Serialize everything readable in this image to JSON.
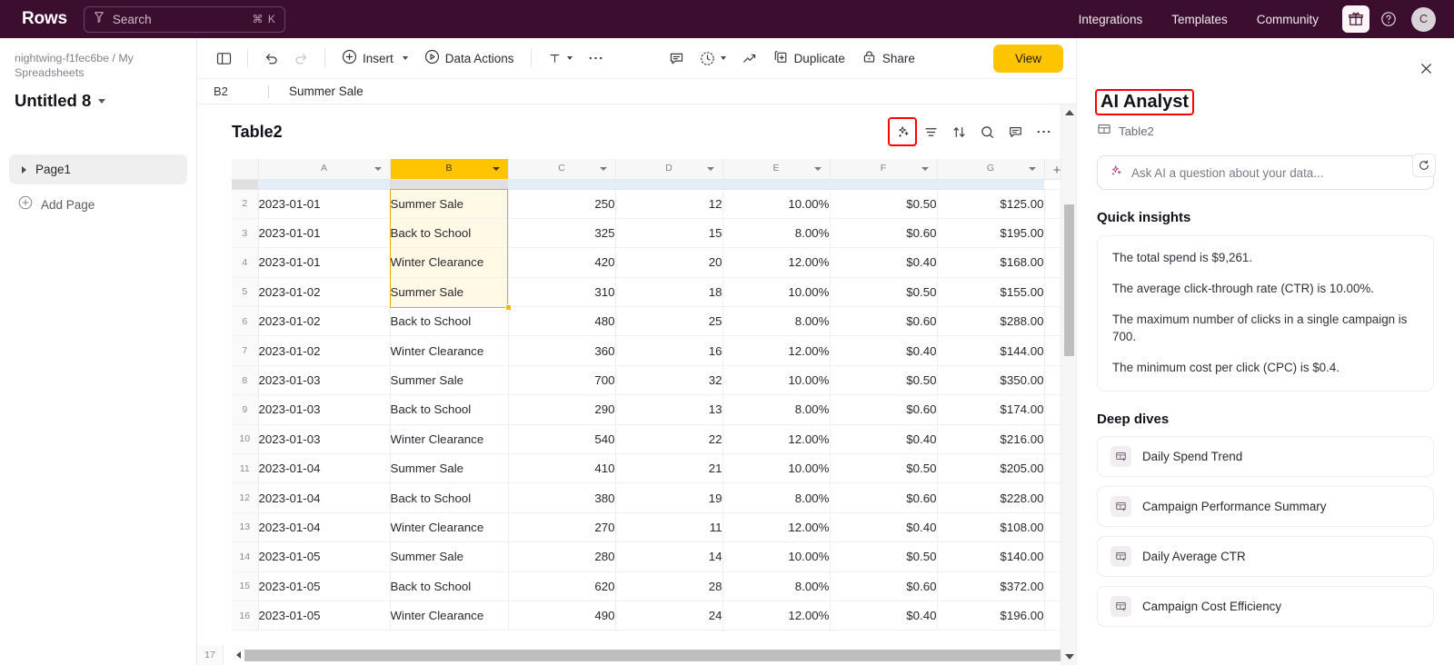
{
  "topnav": {
    "brand": "Rows",
    "search_placeholder": "Search",
    "search_shortcut": "⌘ K",
    "links": [
      {
        "label": "Integrations"
      },
      {
        "label": "Templates"
      },
      {
        "label": "Community"
      }
    ],
    "gift_icon": "gift-icon",
    "help_icon": "help-circle-icon",
    "avatar_initial": "C",
    "bg_color": "#3B0D2E"
  },
  "sidebar": {
    "breadcrumb": "nightwing-f1fec6be / My Spreadsheets",
    "doc_title": "Untitled 8",
    "page_item": "Page1",
    "add_page": "Add Page"
  },
  "toolbar": {
    "panel_toggle_icon": "sidebar-toggle-icon",
    "undo_icon": "undo-icon",
    "redo_icon": "redo-icon",
    "insert_label": "Insert",
    "data_actions_label": "Data Actions",
    "text_format_icon": "text-format-icon",
    "more_icon": "ellipsis-icon",
    "comment_icon": "comment-icon",
    "history_icon": "history-clock-icon",
    "chart_icon": "trend-line-icon",
    "duplicate_label": "Duplicate",
    "share_label": "Share",
    "view_label": "View",
    "view_color": "#FFC400"
  },
  "formula_bar": {
    "cell_ref": "B2",
    "value": "Summer Sale"
  },
  "sheet": {
    "table_name": "Table2",
    "actions": [
      {
        "name": "ai-sparkle-icon",
        "highlighted": true
      },
      {
        "name": "filter-icon",
        "highlighted": false
      },
      {
        "name": "sort-icon",
        "highlighted": false
      },
      {
        "name": "search-icon",
        "highlighted": false
      },
      {
        "name": "comment-icon",
        "highlighted": false
      },
      {
        "name": "more-icon",
        "highlighted": false
      }
    ],
    "columns": [
      "A",
      "B",
      "C",
      "D",
      "E",
      "F",
      "G"
    ],
    "add_column": "+",
    "selected_column": "B",
    "selection_range": "B2:B5",
    "selected_column_color": "#FFC400",
    "selected_cell_bg": "#FFF9E6",
    "selection_border": "#EFA700",
    "rows": [
      {
        "n": "2",
        "cells": [
          "2023-01-01",
          "Summer Sale",
          "250",
          "12",
          "10.00%",
          "$0.50",
          "$125.00"
        ]
      },
      {
        "n": "3",
        "cells": [
          "2023-01-01",
          "Back to School",
          "325",
          "15",
          "8.00%",
          "$0.60",
          "$195.00"
        ]
      },
      {
        "n": "4",
        "cells": [
          "2023-01-01",
          "Winter Clearance",
          "420",
          "20",
          "12.00%",
          "$0.40",
          "$168.00"
        ]
      },
      {
        "n": "5",
        "cells": [
          "2023-01-02",
          "Summer Sale",
          "310",
          "18",
          "10.00%",
          "$0.50",
          "$155.00"
        ]
      },
      {
        "n": "6",
        "cells": [
          "2023-01-02",
          "Back to School",
          "480",
          "25",
          "8.00%",
          "$0.60",
          "$288.00"
        ]
      },
      {
        "n": "7",
        "cells": [
          "2023-01-02",
          "Winter Clearance",
          "360",
          "16",
          "12.00%",
          "$0.40",
          "$144.00"
        ]
      },
      {
        "n": "8",
        "cells": [
          "2023-01-03",
          "Summer Sale",
          "700",
          "32",
          "10.00%",
          "$0.50",
          "$350.00"
        ]
      },
      {
        "n": "9",
        "cells": [
          "2023-01-03",
          "Back to School",
          "290",
          "13",
          "8.00%",
          "$0.60",
          "$174.00"
        ]
      },
      {
        "n": "10",
        "cells": [
          "2023-01-03",
          "Winter Clearance",
          "540",
          "22",
          "12.00%",
          "$0.40",
          "$216.00"
        ]
      },
      {
        "n": "11",
        "cells": [
          "2023-01-04",
          "Summer Sale",
          "410",
          "21",
          "10.00%",
          "$0.50",
          "$205.00"
        ]
      },
      {
        "n": "12",
        "cells": [
          "2023-01-04",
          "Back to School",
          "380",
          "19",
          "8.00%",
          "$0.60",
          "$228.00"
        ]
      },
      {
        "n": "13",
        "cells": [
          "2023-01-04",
          "Winter Clearance",
          "270",
          "11",
          "12.00%",
          "$0.40",
          "$108.00"
        ]
      },
      {
        "n": "14",
        "cells": [
          "2023-01-05",
          "Summer Sale",
          "280",
          "14",
          "10.00%",
          "$0.50",
          "$140.00"
        ]
      },
      {
        "n": "15",
        "cells": [
          "2023-01-05",
          "Back to School",
          "620",
          "28",
          "8.00%",
          "$0.60",
          "$372.00"
        ]
      },
      {
        "n": "16",
        "cells": [
          "2023-01-05",
          "Winter Clearance",
          "490",
          "24",
          "12.00%",
          "$0.40",
          "$196.00"
        ]
      }
    ],
    "last_row_number": "17"
  },
  "ai_panel": {
    "title": "AI Analyst",
    "title_highlight_color": "#FF0000",
    "source_icon": "table-icon",
    "source_name": "Table2",
    "refresh_icon": "refresh-icon",
    "close_icon": "close-icon",
    "ask_placeholder": "Ask AI a question about your data...",
    "ask_icon": "ai-sparkle-icon",
    "ask_return_glyph": "↵",
    "quick_insights_title": "Quick insights",
    "quick_insights": [
      "The total spend is $9,261.",
      "The average click-through rate (CTR) is 10.00%.",
      "The maximum number of clicks in a single campaign is 700.",
      "The minimum cost per click (CPC) is $0.4."
    ],
    "deep_dives_title": "Deep dives",
    "deep_dives": [
      {
        "label": "Daily Spend Trend",
        "icon": "table-add-icon"
      },
      {
        "label": "Campaign Performance Summary",
        "icon": "table-add-icon"
      },
      {
        "label": "Daily Average CTR",
        "icon": "table-add-icon"
      },
      {
        "label": "Campaign Cost Efficiency",
        "icon": "table-add-icon"
      }
    ]
  }
}
